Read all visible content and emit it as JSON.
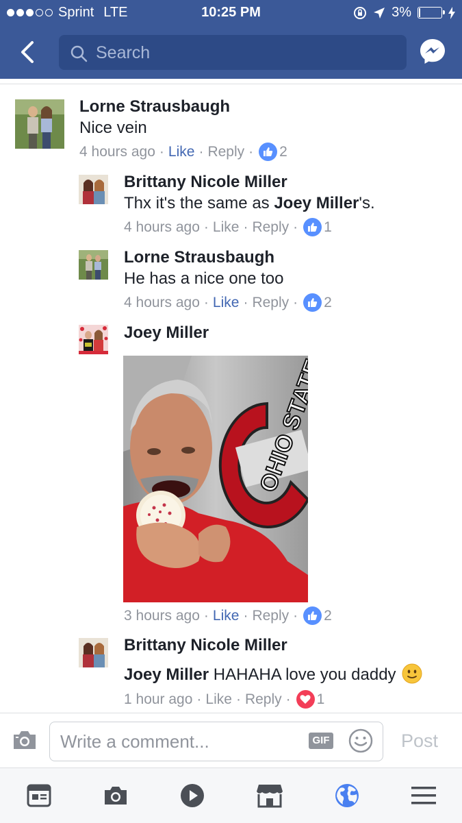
{
  "status_bar": {
    "carrier": "Sprint",
    "network": "LTE",
    "time": "10:25 PM",
    "battery": "3%"
  },
  "search": {
    "placeholder": "Search"
  },
  "comments": [
    {
      "author": "Lorne Strausbaugh",
      "text": "Nice vein",
      "time": "4 hours ago",
      "like": "Like",
      "reply": "Reply",
      "reaction_count": "2",
      "liked": true
    },
    {
      "author": "Brittany Nicole Miller",
      "text_pre": "Thx it's the same as ",
      "mention": "Joey Miller",
      "text_post": "'s.",
      "time": "4 hours ago",
      "like": "Like",
      "reply": "Reply",
      "reaction_count": "1",
      "liked": false
    },
    {
      "author": "Lorne Strausbaugh",
      "text": "He has a nice one too",
      "time": "4 hours ago",
      "like": "Like",
      "reply": "Reply",
      "reaction_count": "2",
      "liked": true
    },
    {
      "author": "Joey Miller",
      "time": "3 hours ago",
      "like": "Like",
      "reply": "Reply",
      "reaction_count": "2",
      "liked": true
    },
    {
      "author": "Brittany Nicole Miller",
      "mention": "Joey Miller",
      "text": " HAHAHA love you daddy",
      "time": "1 hour ago",
      "like": "Like",
      "reply": "Reply",
      "reaction_count": "1",
      "reaction": "heart"
    }
  ],
  "composer": {
    "placeholder": "Write a comment...",
    "gif_label": "GIF",
    "post_label": "Post"
  },
  "tabs": [
    "news-feed",
    "camera",
    "video",
    "marketplace",
    "notifications",
    "menu"
  ],
  "colors": {
    "brand": "#3b5998",
    "like_blue": "#4267b2",
    "reaction_blue": "#5890ff",
    "heart_red": "#f33e58"
  }
}
